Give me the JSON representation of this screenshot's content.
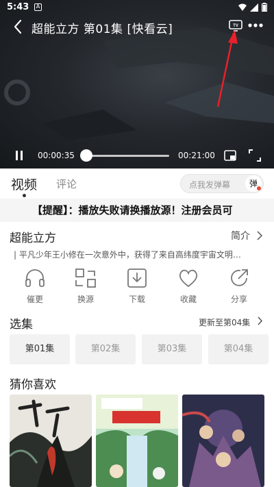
{
  "status_bar": {
    "time": "5:43",
    "notif_letter": "A"
  },
  "player": {
    "title": "超能立方  第01集 [快看云]",
    "current_time": "00:00:35",
    "total_time": "00:21:00",
    "progress": 0.028
  },
  "tabs": {
    "video": "视频",
    "comment": "评论"
  },
  "danmu": {
    "placeholder": "点我发弹幕",
    "button": "弹"
  },
  "notice": "【提醒】：播放失败请换播放源！注册会员可",
  "info": {
    "title": "超能立方",
    "intro_link": "简介",
    "description": "平凡少年王小修在一次意外中，获得了来自高纬度宇宙文明…"
  },
  "actions": [
    {
      "label": "催更",
      "icon": "headphones-icon"
    },
    {
      "label": "换源",
      "icon": "switch-source-icon"
    },
    {
      "label": "下载",
      "icon": "download-icon"
    },
    {
      "label": "收藏",
      "icon": "heart-icon"
    },
    {
      "label": "分享",
      "icon": "share-icon"
    }
  ],
  "episodes": {
    "title": "选集",
    "update_text": "更新至第04集",
    "items": [
      "第01集",
      "第02集",
      "第03集",
      "第04集"
    ],
    "selected": 0
  },
  "recommend": {
    "title": "猜你喜欢"
  },
  "colors": {
    "accent_red": "#e54a3a",
    "annotation_arrow": "#e8202a"
  }
}
